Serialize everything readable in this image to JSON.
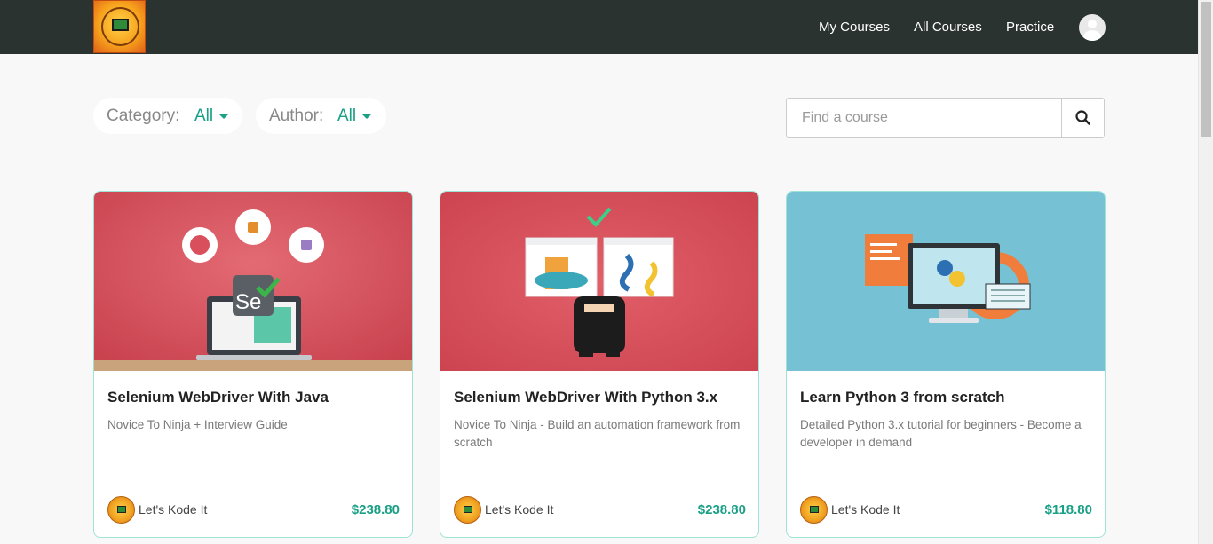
{
  "header": {
    "nav": [
      {
        "label": "My Courses"
      },
      {
        "label": "All Courses"
      },
      {
        "label": "Practice"
      }
    ],
    "avatar_icon": "user-avatar-icon"
  },
  "filters": {
    "category": {
      "label": "Category:",
      "value": "All"
    },
    "author": {
      "label": "Author:",
      "value": "All"
    }
  },
  "search": {
    "placeholder": "Find a course",
    "button_icon": "search-icon"
  },
  "courses": [
    {
      "title": "Selenium WebDriver With Java",
      "subtitle": "Novice To Ninja + Interview Guide",
      "author": "Let's Kode It",
      "price": "$238.80"
    },
    {
      "title": "Selenium WebDriver With Python 3.x",
      "subtitle": "Novice To Ninja - Build an automation framework from scratch",
      "author": "Let's Kode It",
      "price": "$238.80"
    },
    {
      "title": "Learn Python 3 from scratch",
      "subtitle": "Detailed Python 3.x tutorial for beginners - Become a developer in demand",
      "author": "Let's Kode It",
      "price": "$118.80"
    }
  ],
  "colors": {
    "header_bg": "#2b3331",
    "accent": "#1aa086",
    "card_border": "#9fe3d7",
    "thumb_red": "#d9505c",
    "thumb_blue": "#76c2d4"
  }
}
